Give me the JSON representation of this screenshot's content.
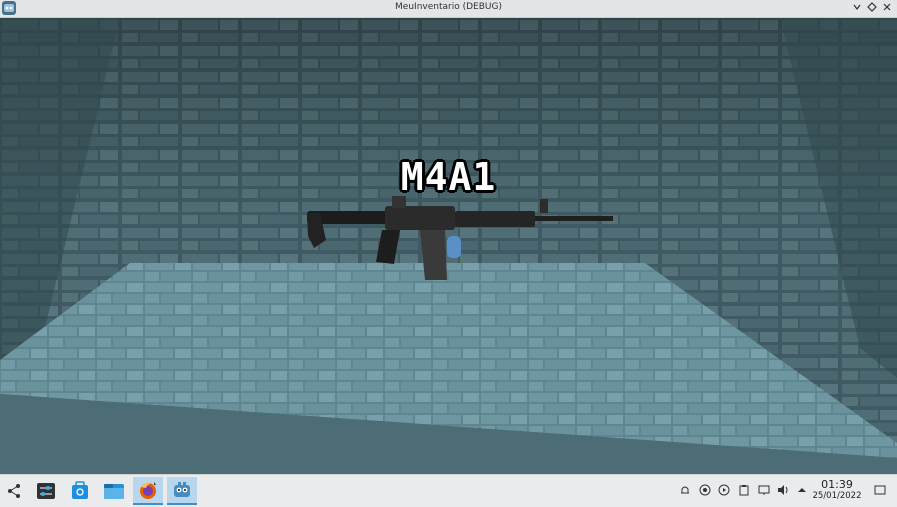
{
  "window": {
    "title": "MeuInventario (DEBUG)"
  },
  "scene": {
    "item_label": "M4A1"
  },
  "taskbar": {
    "apps": [
      "launcher-icon",
      "settings-icon",
      "discover-icon",
      "files-icon",
      "firefox-icon",
      "godot-icon"
    ],
    "clock_time": "01:39",
    "clock_date": "25/01/2022"
  }
}
